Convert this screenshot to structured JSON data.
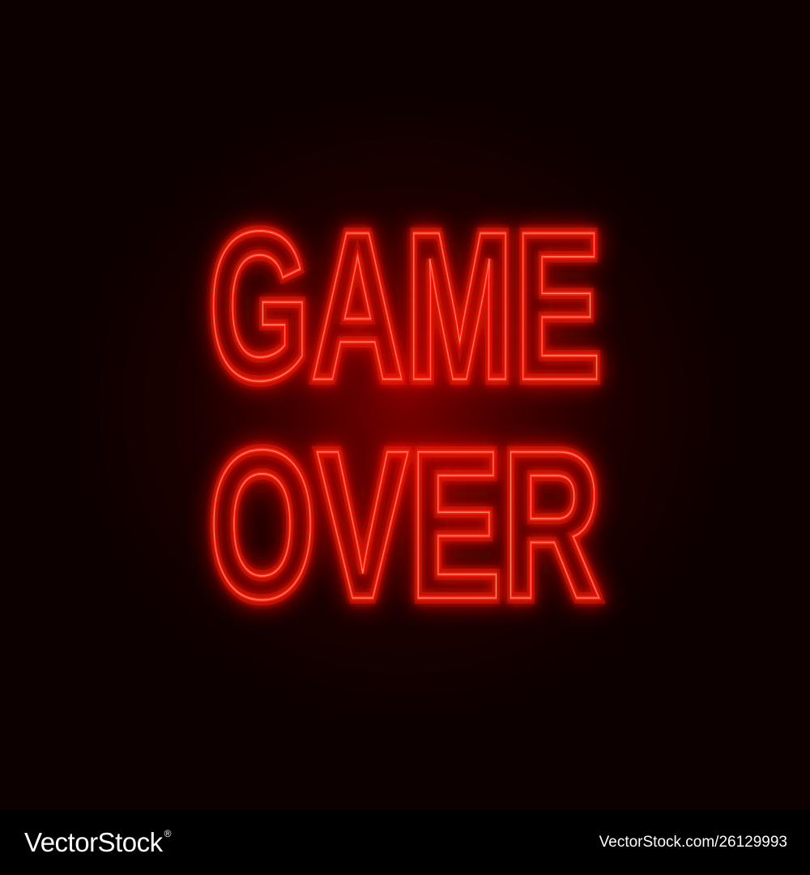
{
  "title": {
    "line1": "GAME",
    "line2": "OVER"
  },
  "colors": {
    "neon": "#ff1a0a",
    "neon_core": "#ff8a70",
    "background": "#000000"
  },
  "watermark": {
    "brand": "VectorStock",
    "registered": "®",
    "stock_id": "VectorStock.com/26129993"
  }
}
